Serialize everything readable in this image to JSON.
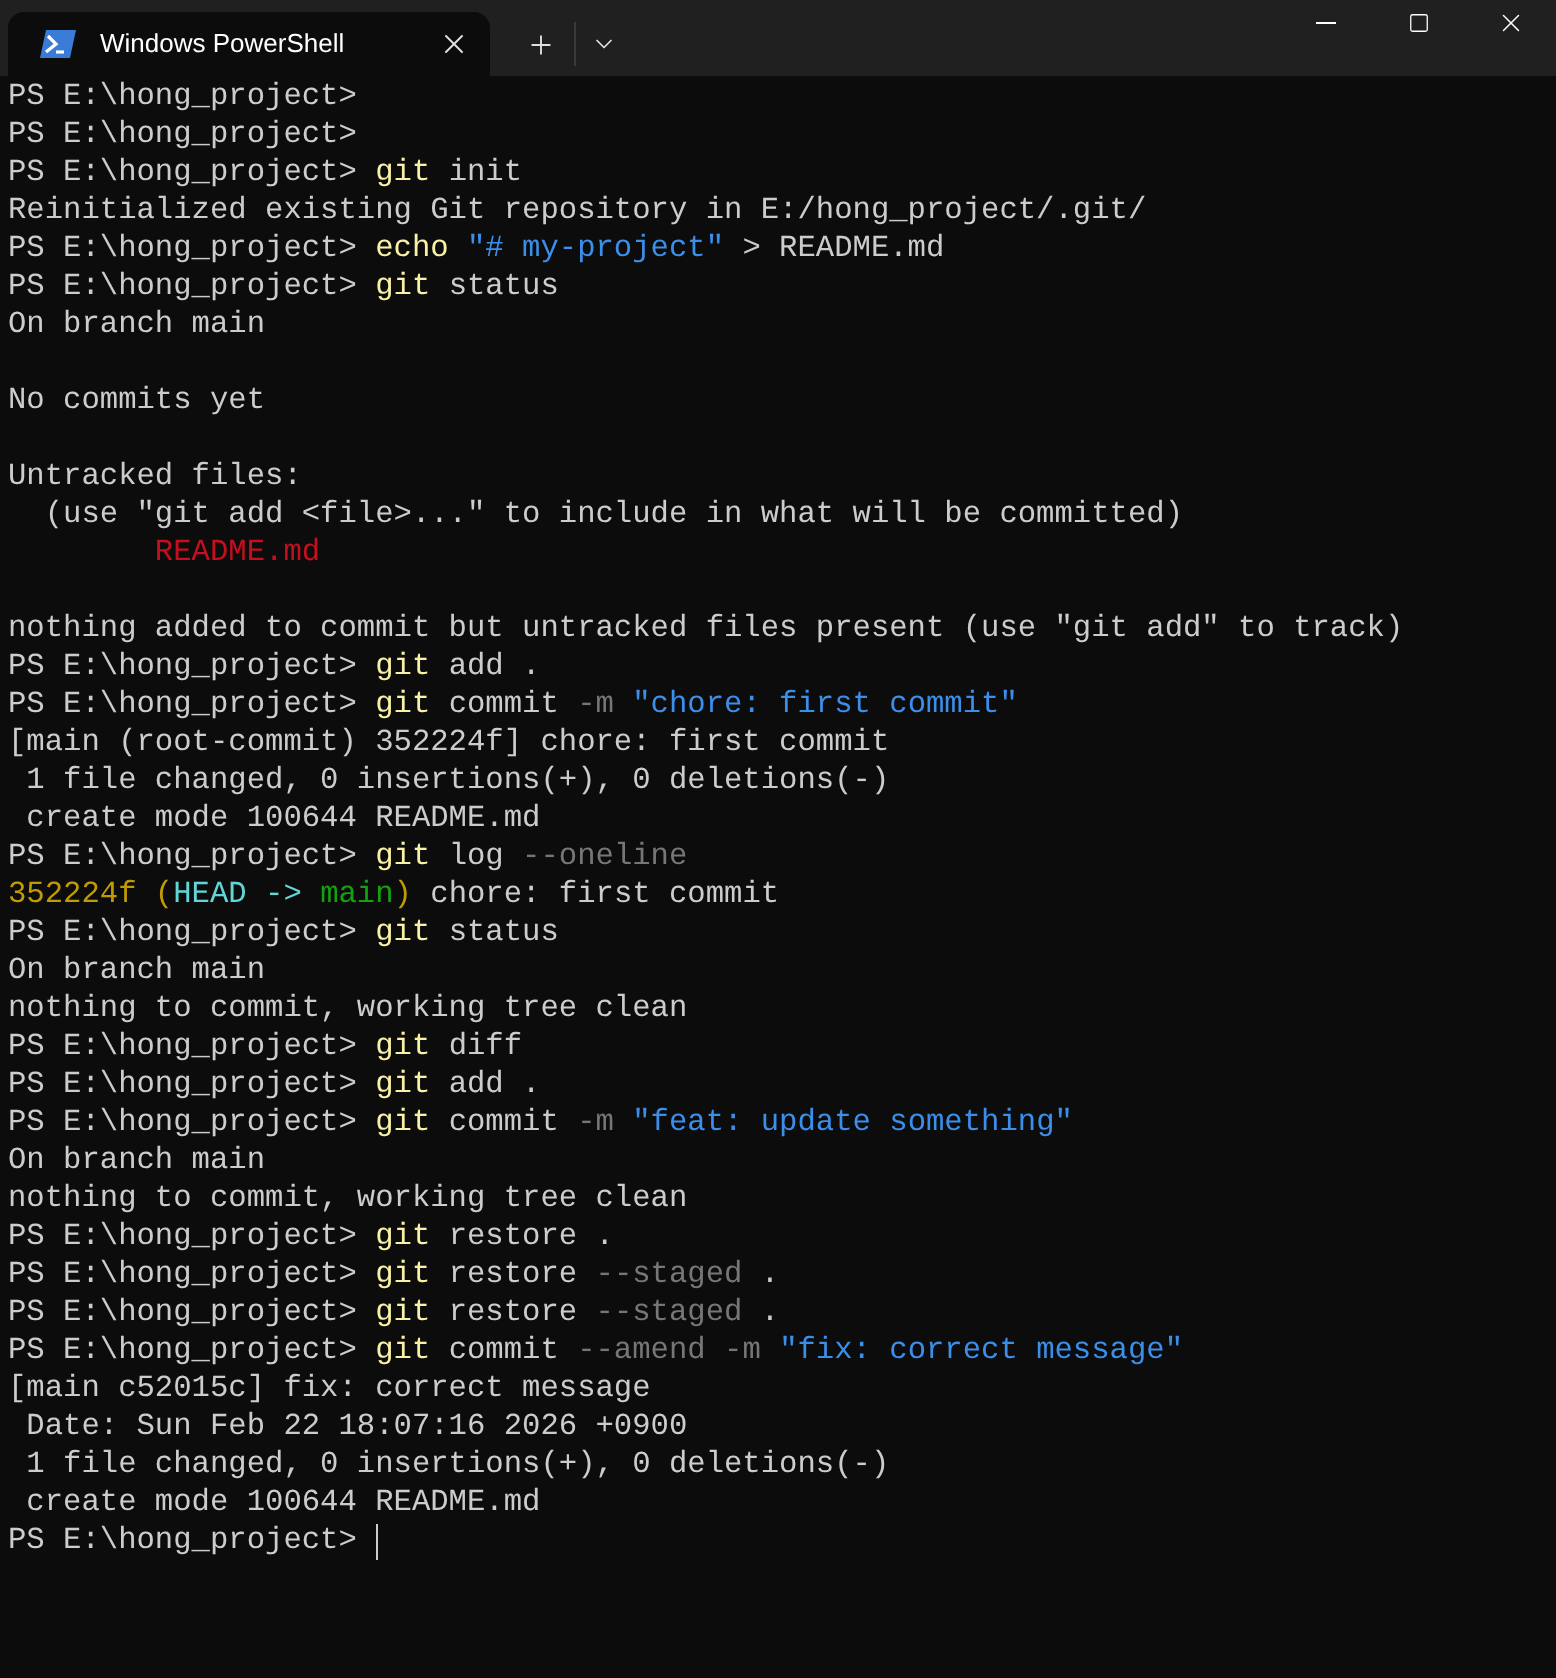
{
  "window": {
    "tabs": [
      {
        "title": "Windows PowerShell",
        "selected": true
      }
    ]
  },
  "terminal": {
    "cursor": true,
    "lines": [
      {
        "kind": "text",
        "segments": [
          {
            "text": "PS E:\\hong_project>",
            "kind": "plain"
          }
        ]
      },
      {
        "kind": "text",
        "segments": [
          {
            "text": "PS E:\\hong_project>",
            "kind": "plain"
          }
        ]
      },
      {
        "kind": "text",
        "segments": [
          {
            "text": "PS E:\\hong_project> ",
            "kind": "plain"
          },
          {
            "text": "git",
            "kind": "command"
          },
          {
            "text": " init",
            "kind": "plain"
          }
        ]
      },
      {
        "kind": "text",
        "segments": [
          {
            "text": "Reinitialized existing Git repository in E:/hong_project/.git/",
            "kind": "plain"
          }
        ]
      },
      {
        "kind": "text",
        "segments": [
          {
            "text": "PS E:\\hong_project> ",
            "kind": "plain"
          },
          {
            "text": "echo ",
            "kind": "command"
          },
          {
            "text": "\"# my-project\"",
            "kind": "string"
          },
          {
            "text": " > README.md",
            "kind": "plain"
          }
        ]
      },
      {
        "kind": "text",
        "segments": [
          {
            "text": "PS E:\\hong_project> ",
            "kind": "plain"
          },
          {
            "text": "git",
            "kind": "command"
          },
          {
            "text": " status",
            "kind": "plain"
          }
        ]
      },
      {
        "kind": "text",
        "segments": [
          {
            "text": "On branch main",
            "kind": "plain"
          }
        ]
      },
      {
        "kind": "blank"
      },
      {
        "kind": "text",
        "segments": [
          {
            "text": "No commits yet",
            "kind": "plain"
          }
        ]
      },
      {
        "kind": "blank"
      },
      {
        "kind": "text",
        "segments": [
          {
            "text": "Untracked files:",
            "kind": "plain"
          }
        ]
      },
      {
        "kind": "text",
        "segments": [
          {
            "text": "  (use \"git add <file>...\" to include in what will be committed)",
            "kind": "plain"
          }
        ]
      },
      {
        "kind": "text",
        "segments": [
          {
            "text": "        README.md",
            "kind": "error"
          }
        ]
      },
      {
        "kind": "blank"
      },
      {
        "kind": "text",
        "segments": [
          {
            "text": "nothing added to commit but untracked files present (use \"git add\" to track)",
            "kind": "plain"
          }
        ]
      },
      {
        "kind": "text",
        "segments": [
          {
            "text": "PS E:\\hong_project> ",
            "kind": "plain"
          },
          {
            "text": "git",
            "kind": "command"
          },
          {
            "text": " add .",
            "kind": "plain"
          }
        ]
      },
      {
        "kind": "text",
        "segments": [
          {
            "text": "PS E:\\hong_project> ",
            "kind": "plain"
          },
          {
            "text": "git",
            "kind": "command"
          },
          {
            "text": " commit ",
            "kind": "plain"
          },
          {
            "text": "-m ",
            "kind": "param"
          },
          {
            "text": "\"chore: first commit\"",
            "kind": "string"
          }
        ]
      },
      {
        "kind": "text",
        "segments": [
          {
            "text": "[main (root-commit) 352224f] chore: first commit",
            "kind": "plain"
          }
        ]
      },
      {
        "kind": "text",
        "segments": [
          {
            "text": " 1 file changed, 0 insertions(+), 0 deletions(-)",
            "kind": "plain"
          }
        ]
      },
      {
        "kind": "text",
        "segments": [
          {
            "text": " create mode 100644 README.md",
            "kind": "plain"
          }
        ]
      },
      {
        "kind": "text",
        "segments": [
          {
            "text": "PS E:\\hong_project> ",
            "kind": "plain"
          },
          {
            "text": "git",
            "kind": "command"
          },
          {
            "text": " log ",
            "kind": "plain"
          },
          {
            "text": "--oneline",
            "kind": "param"
          }
        ]
      },
      {
        "kind": "text",
        "segments": [
          {
            "text": "352224f (",
            "kind": "hash"
          },
          {
            "text": "HEAD -> ",
            "kind": "head"
          },
          {
            "text": "main",
            "kind": "branch"
          },
          {
            "text": ")",
            "kind": "hash"
          },
          {
            "text": " chore: first commit",
            "kind": "plain"
          }
        ]
      },
      {
        "kind": "text",
        "segments": [
          {
            "text": "PS E:\\hong_project> ",
            "kind": "plain"
          },
          {
            "text": "git",
            "kind": "command"
          },
          {
            "text": " status",
            "kind": "plain"
          }
        ]
      },
      {
        "kind": "text",
        "segments": [
          {
            "text": "On branch main",
            "kind": "plain"
          }
        ]
      },
      {
        "kind": "text",
        "segments": [
          {
            "text": "nothing to commit, working tree clean",
            "kind": "plain"
          }
        ]
      },
      {
        "kind": "text",
        "segments": [
          {
            "text": "PS E:\\hong_project> ",
            "kind": "plain"
          },
          {
            "text": "git",
            "kind": "command"
          },
          {
            "text": " diff",
            "kind": "plain"
          }
        ]
      },
      {
        "kind": "text",
        "segments": [
          {
            "text": "PS E:\\hong_project> ",
            "kind": "plain"
          },
          {
            "text": "git",
            "kind": "command"
          },
          {
            "text": " add .",
            "kind": "plain"
          }
        ]
      },
      {
        "kind": "text",
        "segments": [
          {
            "text": "PS E:\\hong_project> ",
            "kind": "plain"
          },
          {
            "text": "git",
            "kind": "command"
          },
          {
            "text": " commit ",
            "kind": "plain"
          },
          {
            "text": "-m ",
            "kind": "param"
          },
          {
            "text": "\"feat: update something\"",
            "kind": "string"
          }
        ]
      },
      {
        "kind": "text",
        "segments": [
          {
            "text": "On branch main",
            "kind": "plain"
          }
        ]
      },
      {
        "kind": "text",
        "segments": [
          {
            "text": "nothing to commit, working tree clean",
            "kind": "plain"
          }
        ]
      },
      {
        "kind": "text",
        "segments": [
          {
            "text": "PS E:\\hong_project> ",
            "kind": "plain"
          },
          {
            "text": "git",
            "kind": "command"
          },
          {
            "text": " restore .",
            "kind": "plain"
          }
        ]
      },
      {
        "kind": "text",
        "segments": [
          {
            "text": "PS E:\\hong_project> ",
            "kind": "plain"
          },
          {
            "text": "git",
            "kind": "command"
          },
          {
            "text": " restore ",
            "kind": "plain"
          },
          {
            "text": "--staged",
            "kind": "param"
          },
          {
            "text": " .",
            "kind": "plain"
          }
        ]
      },
      {
        "kind": "text",
        "segments": [
          {
            "text": "PS E:\\hong_project> ",
            "kind": "plain"
          },
          {
            "text": "git",
            "kind": "command"
          },
          {
            "text": " restore ",
            "kind": "plain"
          },
          {
            "text": "--staged",
            "kind": "param"
          },
          {
            "text": " .",
            "kind": "plain"
          }
        ]
      },
      {
        "kind": "text",
        "segments": [
          {
            "text": "PS E:\\hong_project> ",
            "kind": "plain"
          },
          {
            "text": "git",
            "kind": "command"
          },
          {
            "text": " commit ",
            "kind": "plain"
          },
          {
            "text": "--amend -m ",
            "kind": "param"
          },
          {
            "text": "\"fix: correct message\"",
            "kind": "string"
          }
        ]
      },
      {
        "kind": "text",
        "segments": [
          {
            "text": "[main c52015c] fix: correct message",
            "kind": "plain"
          }
        ]
      },
      {
        "kind": "text",
        "segments": [
          {
            "text": " Date: Sun Feb 22 18:07:16 2026 +0900",
            "kind": "plain"
          }
        ]
      },
      {
        "kind": "text",
        "segments": [
          {
            "text": " 1 file changed, 0 insertions(+), 0 deletions(-)",
            "kind": "plain"
          }
        ]
      },
      {
        "kind": "text",
        "segments": [
          {
            "text": " create mode 100644 README.md",
            "kind": "plain"
          }
        ]
      },
      {
        "kind": "text",
        "segments": [
          {
            "text": "PS E:\\hong_project> ",
            "kind": "plain"
          }
        ]
      }
    ]
  }
}
